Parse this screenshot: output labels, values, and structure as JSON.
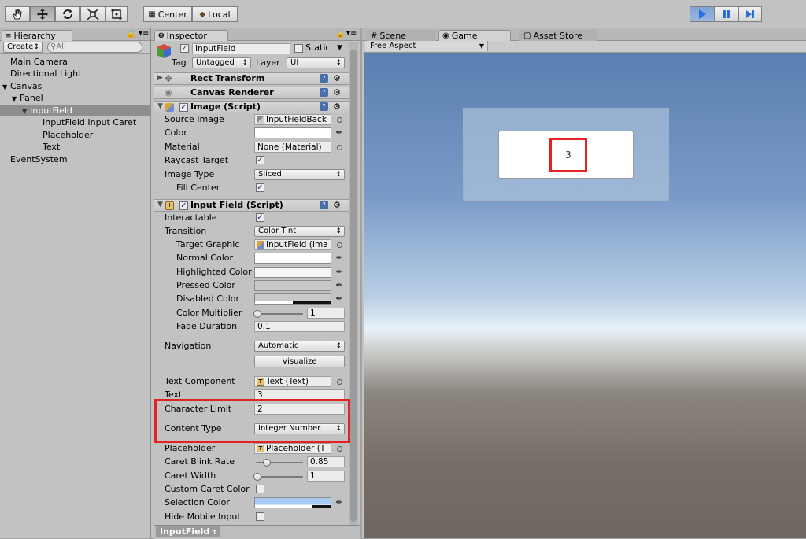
{
  "toolbar": {
    "pivot_label": "Center",
    "space_label": "Local"
  },
  "hierarchy": {
    "tab_label": "Hierarchy",
    "create_label": "Create",
    "search_placeholder": "All",
    "items": [
      {
        "label": "Main Camera"
      },
      {
        "label": "Directional Light"
      },
      {
        "label": "Canvas"
      },
      {
        "label": "Panel"
      },
      {
        "label": "InputField"
      },
      {
        "label": "InputField Input Caret"
      },
      {
        "label": "Placeholder"
      },
      {
        "label": "Text"
      },
      {
        "label": "EventSystem"
      }
    ]
  },
  "inspector": {
    "tab_label": "Inspector",
    "object_name": "InputField",
    "static_label": "Static",
    "tag_label": "Tag",
    "tag_value": "Untagged",
    "layer_label": "Layer",
    "layer_value": "UI",
    "components": {
      "rect_transform": "Rect Transform",
      "canvas_renderer": "Canvas Renderer",
      "image": "Image (Script)",
      "input_field": "Input Field (Script)"
    },
    "image": {
      "source_image_label": "Source Image",
      "source_image_value": "InputFieldBack",
      "color_label": "Color",
      "material_label": "Material",
      "material_value": "None (Material)",
      "raycast_label": "Raycast Target",
      "image_type_label": "Image Type",
      "image_type_value": "Sliced",
      "fill_center_label": "Fill Center"
    },
    "input": {
      "interactable_label": "Interactable",
      "transition_label": "Transition",
      "transition_value": "Color Tint",
      "target_graphic_label": "Target Graphic",
      "target_graphic_value": "InputField (Ima",
      "normal_color_label": "Normal Color",
      "highlighted_color_label": "Highlighted Color",
      "pressed_color_label": "Pressed Color",
      "disabled_color_label": "Disabled Color",
      "color_multiplier_label": "Color Multiplier",
      "color_multiplier_value": "1",
      "fade_duration_label": "Fade Duration",
      "fade_duration_value": "0.1",
      "navigation_label": "Navigation",
      "navigation_value": "Automatic",
      "visualize_label": "Visualize",
      "text_component_label": "Text Component",
      "text_component_value": "Text (Text)",
      "text_label": "Text",
      "text_value": "3",
      "char_limit_label": "Character Limit",
      "char_limit_value": "2",
      "content_type_label": "Content Type",
      "content_type_value": "Integer Number",
      "placeholder_label": "Placeholder",
      "placeholder_value": "Placeholder (T",
      "caret_blink_label": "Caret Blink Rate",
      "caret_blink_value": "0.85",
      "caret_width_label": "Caret Width",
      "caret_width_value": "1",
      "custom_caret_label": "Custom Caret Color",
      "selection_color_label": "Selection Color",
      "hide_mobile_label": "Hide Mobile Input"
    },
    "footer_label": "InputField"
  },
  "scene_tabs": {
    "scene": "Scene",
    "game": "Game",
    "asset_store": "Asset Store"
  },
  "game": {
    "aspect_value": "Free Aspect",
    "input_text": "3"
  },
  "colors": {
    "highlight_red": "#e52121",
    "play_blue": "#2a6edb",
    "selection_color": "#a8caf5"
  }
}
